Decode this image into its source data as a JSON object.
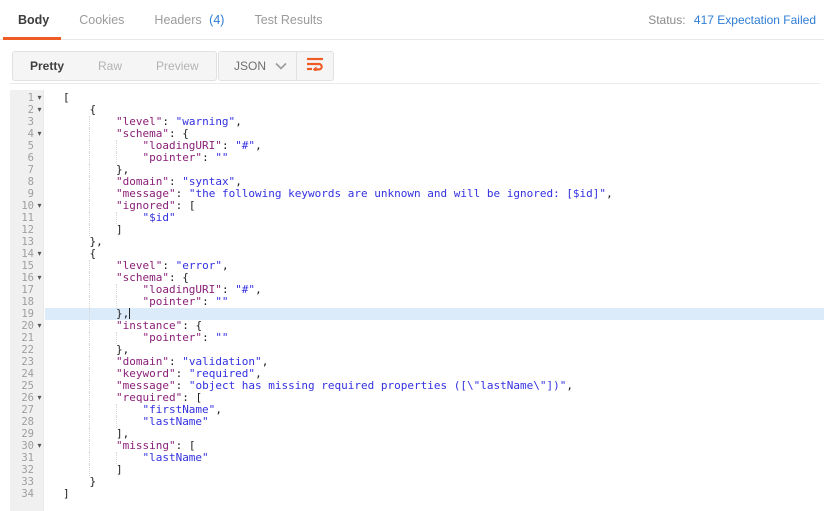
{
  "colors": {
    "accent": "#EF5B25",
    "blue": "#2E7CD6",
    "key": "#8A1F77",
    "str": "#3330E0",
    "punct": "#202020",
    "hl": "#DCEBFA"
  },
  "header": {
    "tabs": [
      {
        "label": "Body"
      },
      {
        "label": "Cookies"
      },
      {
        "label": "Headers",
        "count": "(4)"
      },
      {
        "label": "Test Results"
      }
    ],
    "status_label": "Status:",
    "status_value": "417 Expectation Failed"
  },
  "toolbar": {
    "views": [
      "Pretty",
      "Raw",
      "Preview"
    ],
    "active_view": "Pretty",
    "language": "JSON"
  },
  "code": {
    "language": "JSON",
    "lines": [
      {
        "n": 1,
        "ind": 0,
        "f": true,
        "seg": [
          [
            "p",
            "["
          ]
        ]
      },
      {
        "n": 2,
        "ind": 1,
        "f": true,
        "seg": [
          [
            "p",
            "{"
          ]
        ]
      },
      {
        "n": 3,
        "ind": 2,
        "seg": [
          [
            "k",
            "\"level\""
          ],
          [
            "p",
            ": "
          ],
          [
            "s",
            "\"warning\""
          ],
          [
            "p",
            ","
          ]
        ]
      },
      {
        "n": 4,
        "ind": 2,
        "f": true,
        "seg": [
          [
            "k",
            "\"schema\""
          ],
          [
            "p",
            ": {"
          ]
        ]
      },
      {
        "n": 5,
        "ind": 3,
        "seg": [
          [
            "k",
            "\"loadingURI\""
          ],
          [
            "p",
            ": "
          ],
          [
            "s",
            "\"#\""
          ],
          [
            "p",
            ","
          ]
        ]
      },
      {
        "n": 6,
        "ind": 3,
        "seg": [
          [
            "k",
            "\"pointer\""
          ],
          [
            "p",
            ": "
          ],
          [
            "s",
            "\"\""
          ]
        ]
      },
      {
        "n": 7,
        "ind": 2,
        "seg": [
          [
            "p",
            "},"
          ]
        ]
      },
      {
        "n": 8,
        "ind": 2,
        "seg": [
          [
            "k",
            "\"domain\""
          ],
          [
            "p",
            ": "
          ],
          [
            "s",
            "\"syntax\""
          ],
          [
            "p",
            ","
          ]
        ]
      },
      {
        "n": 9,
        "ind": 2,
        "seg": [
          [
            "k",
            "\"message\""
          ],
          [
            "p",
            ": "
          ],
          [
            "s",
            "\"the following keywords are unknown and will be ignored: [$id]\""
          ],
          [
            "p",
            ","
          ]
        ]
      },
      {
        "n": 10,
        "ind": 2,
        "f": true,
        "seg": [
          [
            "k",
            "\"ignored\""
          ],
          [
            "p",
            ": ["
          ]
        ]
      },
      {
        "n": 11,
        "ind": 3,
        "seg": [
          [
            "s",
            "\"$id\""
          ]
        ]
      },
      {
        "n": 12,
        "ind": 2,
        "seg": [
          [
            "p",
            "]"
          ]
        ]
      },
      {
        "n": 13,
        "ind": 1,
        "seg": [
          [
            "p",
            "},"
          ]
        ]
      },
      {
        "n": 14,
        "ind": 1,
        "f": true,
        "seg": [
          [
            "p",
            "{"
          ]
        ]
      },
      {
        "n": 15,
        "ind": 2,
        "seg": [
          [
            "k",
            "\"level\""
          ],
          [
            "p",
            ": "
          ],
          [
            "s",
            "\"error\""
          ],
          [
            "p",
            ","
          ]
        ]
      },
      {
        "n": 16,
        "ind": 2,
        "f": true,
        "seg": [
          [
            "k",
            "\"schema\""
          ],
          [
            "p",
            ": {"
          ]
        ]
      },
      {
        "n": 17,
        "ind": 3,
        "seg": [
          [
            "k",
            "\"loadingURI\""
          ],
          [
            "p",
            ": "
          ],
          [
            "s",
            "\"#\""
          ],
          [
            "p",
            ","
          ]
        ]
      },
      {
        "n": 18,
        "ind": 3,
        "seg": [
          [
            "k",
            "\"pointer\""
          ],
          [
            "p",
            ": "
          ],
          [
            "s",
            "\"\""
          ]
        ]
      },
      {
        "n": 19,
        "ind": 2,
        "h": true,
        "c": true,
        "seg": [
          [
            "p",
            "},"
          ]
        ]
      },
      {
        "n": 20,
        "ind": 2,
        "f": true,
        "seg": [
          [
            "k",
            "\"instance\""
          ],
          [
            "p",
            ": {"
          ]
        ]
      },
      {
        "n": 21,
        "ind": 3,
        "seg": [
          [
            "k",
            "\"pointer\""
          ],
          [
            "p",
            ": "
          ],
          [
            "s",
            "\"\""
          ]
        ]
      },
      {
        "n": 22,
        "ind": 2,
        "seg": [
          [
            "p",
            "},"
          ]
        ]
      },
      {
        "n": 23,
        "ind": 2,
        "seg": [
          [
            "k",
            "\"domain\""
          ],
          [
            "p",
            ": "
          ],
          [
            "s",
            "\"validation\""
          ],
          [
            "p",
            ","
          ]
        ]
      },
      {
        "n": 24,
        "ind": 2,
        "seg": [
          [
            "k",
            "\"keyword\""
          ],
          [
            "p",
            ": "
          ],
          [
            "s",
            "\"required\""
          ],
          [
            "p",
            ","
          ]
        ]
      },
      {
        "n": 25,
        "ind": 2,
        "seg": [
          [
            "k",
            "\"message\""
          ],
          [
            "p",
            ": "
          ],
          [
            "s",
            "\"object has missing required properties ([\\\"lastName\\\"])\""
          ],
          [
            "p",
            ","
          ]
        ]
      },
      {
        "n": 26,
        "ind": 2,
        "f": true,
        "seg": [
          [
            "k",
            "\"required\""
          ],
          [
            "p",
            ": ["
          ]
        ]
      },
      {
        "n": 27,
        "ind": 3,
        "seg": [
          [
            "s",
            "\"firstName\""
          ],
          [
            "p",
            ","
          ]
        ]
      },
      {
        "n": 28,
        "ind": 3,
        "seg": [
          [
            "s",
            "\"lastName\""
          ]
        ]
      },
      {
        "n": 29,
        "ind": 2,
        "seg": [
          [
            "p",
            "],"
          ]
        ]
      },
      {
        "n": 30,
        "ind": 2,
        "f": true,
        "seg": [
          [
            "k",
            "\"missing\""
          ],
          [
            "p",
            ": ["
          ]
        ]
      },
      {
        "n": 31,
        "ind": 3,
        "seg": [
          [
            "s",
            "\"lastName\""
          ]
        ]
      },
      {
        "n": 32,
        "ind": 2,
        "seg": [
          [
            "p",
            "]"
          ]
        ]
      },
      {
        "n": 33,
        "ind": 1,
        "seg": [
          [
            "p",
            "}"
          ]
        ]
      },
      {
        "n": 34,
        "ind": 0,
        "seg": [
          [
            "p",
            "]"
          ]
        ]
      }
    ]
  }
}
